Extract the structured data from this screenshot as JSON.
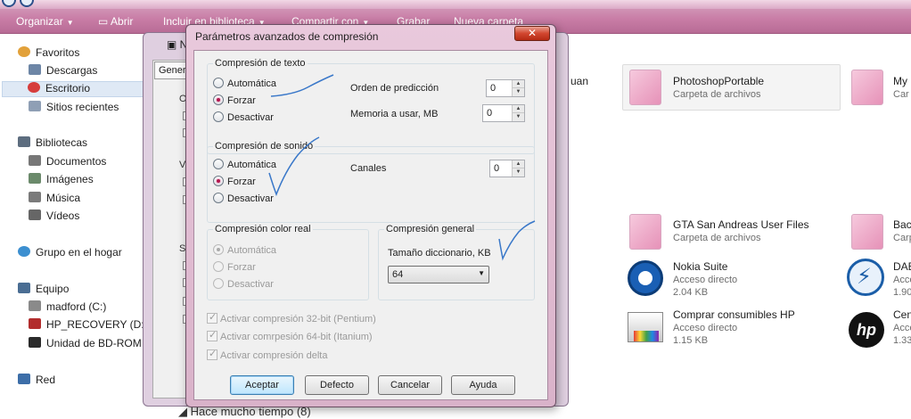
{
  "toolbar": {
    "organize": "Organizar",
    "open": "Abrir",
    "include_library": "Incluir en biblioteca",
    "share_with": "Compartir con",
    "burn": "Grabar",
    "new_folder": "Nueva carpeta"
  },
  "nav": {
    "favorites": "Favoritos",
    "downloads": "Descargas",
    "desktop": "Escritorio",
    "recent": "Sitios recientes",
    "libraries": "Bibliotecas",
    "documents": "Documentos",
    "images": "Imágenes",
    "music": "Música",
    "videos": "Vídeos",
    "homegroup": "Grupo en el hogar",
    "computer": "Equipo",
    "drive_c": "madford (C:)",
    "drive_d": "HP_RECOVERY (D:)",
    "drive_bd": "Unidad de BD-ROM (",
    "network": "Red"
  },
  "content": {
    "partial_juan": "uan",
    "items": [
      {
        "name": "PhotoshopPortable",
        "sub": "Carpeta de archivos",
        "size": ""
      },
      {
        "name": "My",
        "sub": "Car",
        "size": ""
      },
      {
        "name": "GTA San Andreas User Files",
        "sub": "Carpeta de archivos",
        "size": ""
      },
      {
        "name": "Back",
        "sub": "Carp",
        "size": ""
      },
      {
        "name": "Nokia Suite",
        "sub": "Acceso directo",
        "size": "2.04 KB"
      },
      {
        "name": "DAE",
        "sub": "Acce",
        "size": "1.90"
      },
      {
        "name": "Comprar consumibles HP",
        "sub": "Acceso directo",
        "size": "1.15 KB"
      },
      {
        "name": "Cen",
        "sub": "Acce",
        "size": "1.33"
      }
    ],
    "bottom_text": "Hace mucho tiempo (8)"
  },
  "behind_dialog": {
    "title": "Nom",
    "tab": "Genera"
  },
  "dialog": {
    "title": "Parámetros avanzados de compresión",
    "close": "✕",
    "text_group": {
      "title": "Compresión de texto",
      "options": [
        "Automática",
        "Forzar",
        "Desactivar"
      ],
      "selected": "Forzar"
    },
    "prediction_label": "Orden de predicción",
    "prediction_value": "0",
    "memory_label": "Memoria a usar, MB",
    "memory_value": "0",
    "sound_group": {
      "title": "Compresión de sonido",
      "options": [
        "Automática",
        "Forzar",
        "Desactivar"
      ],
      "selected": "Forzar"
    },
    "channels_label": "Canales",
    "channels_value": "0",
    "truecolor_group": {
      "title": "Compresión color real",
      "options": [
        "Automática",
        "Forzar",
        "Desactivar"
      ],
      "selected": "Automática"
    },
    "general_group": {
      "title": "Compresión general",
      "dict_label": "Tamaño diccionario, KB",
      "dict_value": "64"
    },
    "checks": [
      "Activar compresión 32-bit (Pentium)",
      "Activar comrpesión 64-bit (Itanium)",
      "Activar compresión delta"
    ],
    "buttons": {
      "ok": "Aceptar",
      "default": "Defecto",
      "cancel": "Cancelar",
      "help": "Ayuda"
    }
  }
}
